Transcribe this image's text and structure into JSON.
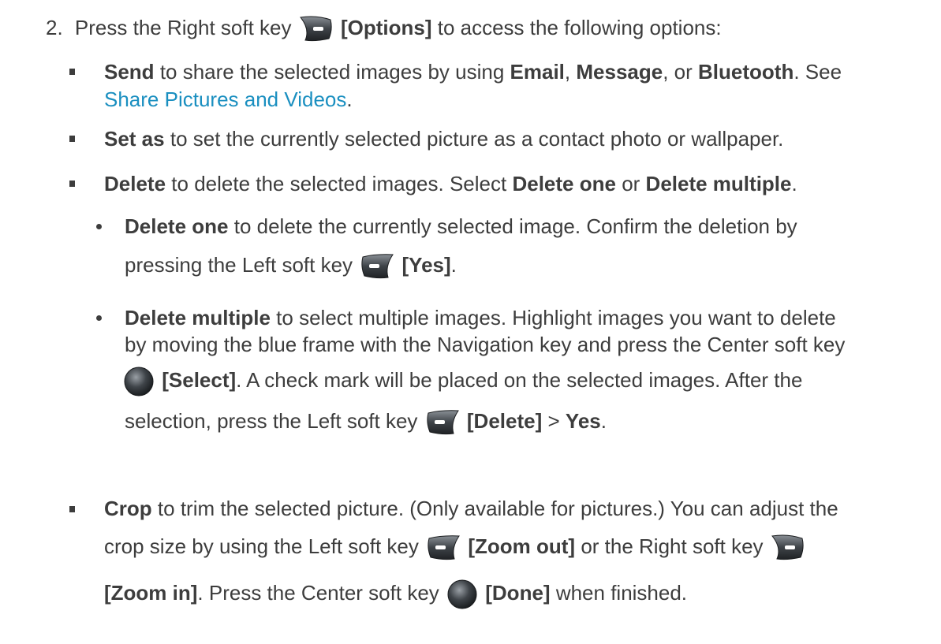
{
  "step": {
    "number": "2.",
    "pre": "Press the Right soft key",
    "bold": "[Options]",
    "post": "to access the following options:"
  },
  "send": {
    "term": "Send",
    "t1": "to share the selected images by using",
    "email": "Email",
    "comma1": ",",
    "message": "Message",
    "comma2": ", or",
    "bluetooth": "Bluetooth",
    "t2": ". See",
    "link": "Share Pictures and Videos",
    "end": "."
  },
  "set_as": {
    "term": "Set as",
    "text": "to set the currently selected picture as a contact photo or wallpaper."
  },
  "delete": {
    "term": "Delete",
    "t1": "to delete the selected images. Select",
    "opt1": "Delete one",
    "or": "or",
    "opt2": "Delete multiple",
    "end": "."
  },
  "delete_one": {
    "term": "Delete one",
    "line1": "to delete the currently selected image. Confirm the deletion by",
    "line2_pre": "pressing the Left soft key",
    "line2_bold": "[Yes]",
    "line2_end": "."
  },
  "delete_multiple": {
    "term": "Delete multiple",
    "line1": "to select multiple images. Highlight images you want to delete",
    "line2": "by moving the blue frame with the Navigation key and press the Center soft key",
    "line3_bold": "[Select]",
    "line3_text": ". A check mark will be placed on the selected images. After the",
    "line4_pre": "selection, press the Left soft key",
    "line4_bold": "[Delete]",
    "line4_gt": ">",
    "line4_yes": "Yes",
    "line4_end": "."
  },
  "crop": {
    "term": "Crop",
    "line1": "to trim the selected picture. (Only available for pictures.) You can adjust the",
    "line2_pre": "crop size by using the Left soft key",
    "line2_bold": "[Zoom out]",
    "line2_mid": "or the Right soft key",
    "line3_bold1": "[Zoom in]",
    "line3_t1": ". Press the Center soft key",
    "line3_bold2": "[Done]",
    "line3_end": "when finished."
  },
  "icons": {
    "right_key": "right-soft-key-icon",
    "left_key": "left-soft-key-icon",
    "center_key": "center-soft-key-icon"
  }
}
